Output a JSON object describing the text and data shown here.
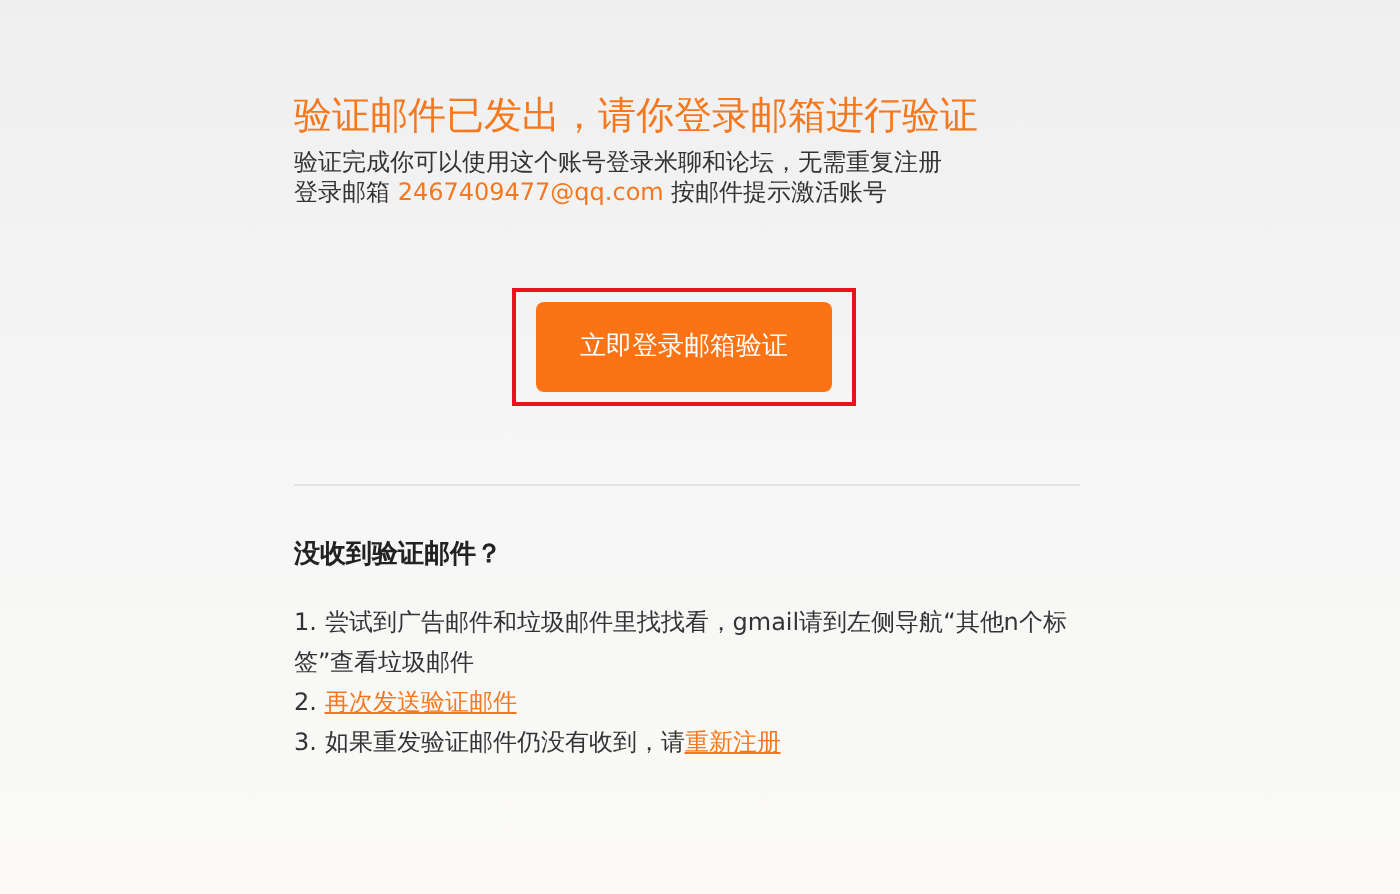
{
  "title": "验证邮件已发出，请你登录邮箱进行验证",
  "intro": "验证完成你可以使用这个账号登录米聊和论坛，无需重复注册",
  "email_line": {
    "prefix": "登录邮箱",
    "email": "2467409477@qq.com",
    "suffix": "按邮件提示激活账号"
  },
  "button": {
    "label": "立即登录邮箱验证",
    "highlighted": true
  },
  "help": {
    "heading": "没收到验证邮件？",
    "steps": [
      {
        "number": "1.",
        "text": "尝试到广告邮件和垃圾邮件里找找看，gmail请到左侧导航“其他n个标签”查看垃圾邮件"
      },
      {
        "number": "2.",
        "link": "再次发送验证邮件"
      },
      {
        "number": "3.",
        "text": "如果重发验证邮件仍没有收到，请",
        "link": "重新注册"
      }
    ]
  }
}
